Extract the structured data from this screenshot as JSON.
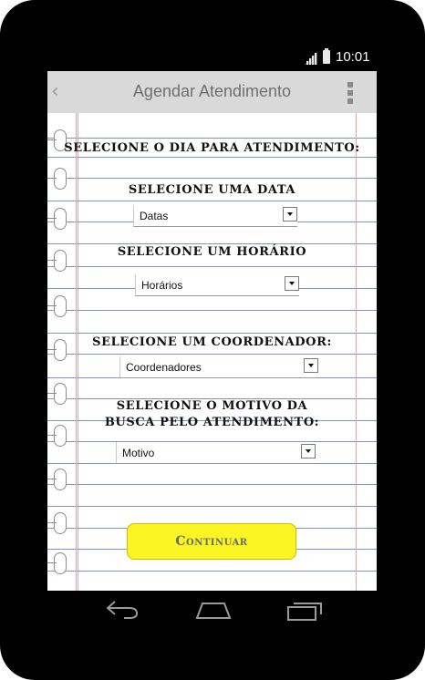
{
  "status_bar": {
    "time": "10:01"
  },
  "app_bar": {
    "title": "Agendar Atendimento"
  },
  "form": {
    "heading": "Selecione o dia para atendimento:",
    "date_label": "Selecione uma data",
    "date_select": "Datas",
    "time_label": "Selecione um horário",
    "time_select": "Horários",
    "coord_label": "Selecione um coordenador:",
    "coord_select": "Coordenadores",
    "reason_label_line1": "Selecione o motivo da",
    "reason_label_line2": "busca pelo atendimento:",
    "reason_select": "Motivo",
    "continue_button": "Continuar"
  },
  "colors": {
    "device": "#000000",
    "app_bar": "#d9d9d9",
    "ruled_line": "#7f95c0",
    "margin_line": "#e7a5a5",
    "button": "#fbf524"
  },
  "icons": {
    "back": "chevron-left-icon",
    "menu": "overflow-menu-icon",
    "nav_back": "back-arrow-icon",
    "nav_home": "home-icon",
    "nav_recents": "recents-icon"
  }
}
